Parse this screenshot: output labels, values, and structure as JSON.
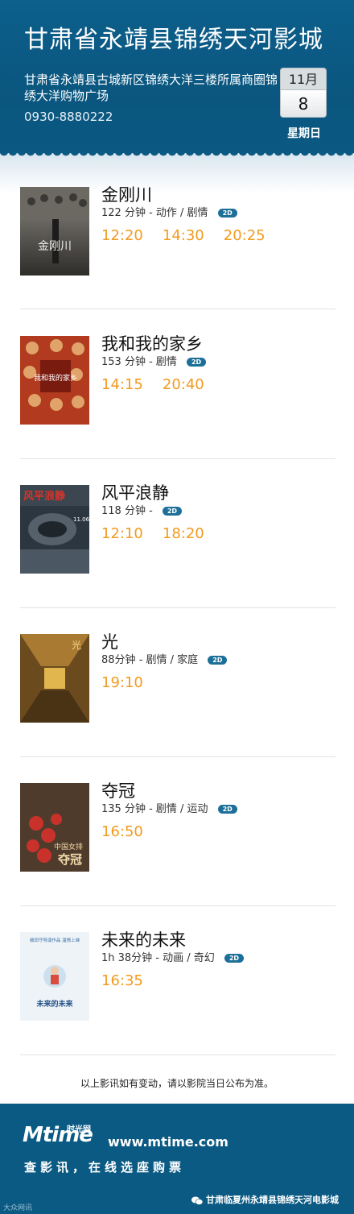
{
  "header": {
    "cinema_name": "甘肃省永靖县锦绣天河影城",
    "address": "甘肃省永靖县古城新区锦绣大洋三楼所属商圈锦绣大洋购物广场",
    "phone": "0930-8880222",
    "date": {
      "month": "11月",
      "day": "8",
      "weekday": "星期日"
    }
  },
  "movies": [
    {
      "title": "金刚川",
      "duration": "122 分钟",
      "genres": "- 动作 / 剧情",
      "format": "2D",
      "times": [
        "12:20",
        "14:30",
        "20:25"
      ]
    },
    {
      "title": "我和我的家乡",
      "duration": "153 分钟",
      "genres": "- 剧情",
      "format": "2D",
      "times": [
        "14:15",
        "20:40"
      ]
    },
    {
      "title": "风平浪静",
      "duration": "118 分钟",
      "genres": "-",
      "format": "2D",
      "times": [
        "12:10",
        "18:20"
      ]
    },
    {
      "title": "光",
      "duration": "88分钟",
      "genres": "- 剧情 / 家庭",
      "format": "2D",
      "times": [
        "19:10"
      ]
    },
    {
      "title": "夺冠",
      "duration": "135 分钟",
      "genres": "- 剧情 / 运动",
      "format": "2D",
      "times": [
        "16:50"
      ]
    },
    {
      "title": "未来的未来",
      "duration": "1h 38分钟",
      "genres": "- 动画 / 奇幻",
      "format": "2D",
      "times": [
        "16:35"
      ]
    }
  ],
  "poster_text": {
    "p1": "金刚川",
    "p2": "我和我的家乡",
    "p3": "风平浪静",
    "p3_date": "11.06",
    "p4": "光",
    "p5_a": "中国女排",
    "p5_b": "夺冠",
    "p6_title": "未来的未来",
    "p6_top": "细田守导演作品 温情上映"
  },
  "notice": "以上影讯如有变动，请以影院当日公布为准。",
  "footer": {
    "logo": "Mtime",
    "logo_cn": "时光网",
    "url": "www.mtime.com",
    "slogan": "查影讯，在线选座购票",
    "watermark_left": "大众网讯",
    "wechat_account": "甘肃临夏州永靖县锦绣天河电影城"
  },
  "colors": {
    "header_bg": "#0b5a84",
    "time_orange": "#f39a1e",
    "badge_blue": "#1c6f98"
  }
}
